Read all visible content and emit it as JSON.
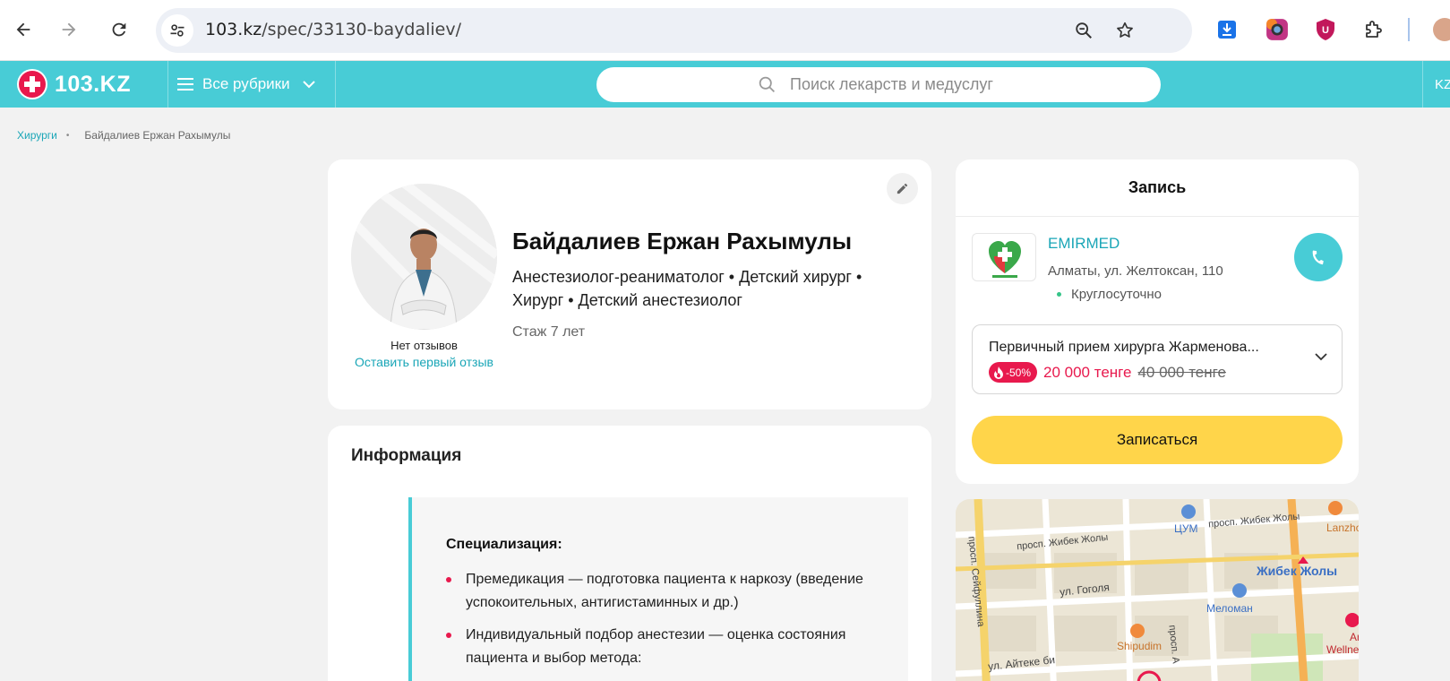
{
  "browser": {
    "url_host": "103.kz",
    "url_path": "/spec/33130-baydaliev/"
  },
  "header": {
    "logo_text": "103.KZ",
    "rubrics_label": "Все рубрики",
    "search_placeholder": "Поиск лекарств и медуслуг",
    "lang": "KZ"
  },
  "breadcrumb": {
    "parent": "Хирурги",
    "current": "Байдалиев Ержан Рахымулы"
  },
  "profile": {
    "name": "Байдалиев Ержан Рахымулы",
    "specialties": "Анестезиолог-реаниматолог • Детский хирург • Хирург • Детский анестезиолог",
    "experience": "Стаж 7 лет",
    "reviews_none": "Нет отзывов",
    "reviews_link": "Оставить первый отзыв"
  },
  "info": {
    "title": "Информация",
    "spec_heading": "Специализация:",
    "bullets": [
      "Премедикация — подготовка пациента к наркозу (введение успокоительных, антигистаминных и др.)",
      "Индивидуальный подбор анестезии — оценка состояния пациента и выбор метода:"
    ]
  },
  "booking": {
    "title": "Запись",
    "clinic_name": "EMIRMED",
    "clinic_address": "Алматы, ул. Желтоксан, 110",
    "clinic_hours": "Круглосуточно",
    "service_name": "Первичный прием хирурга Жарменова...",
    "discount": "-50%",
    "price_new": "20 000 тенге",
    "price_old": "40 000 тенге",
    "book_label": "Записаться"
  },
  "map": {
    "labels": {
      "cum": "ЦУМ",
      "zhibek1": "просп. Жибек Жолы",
      "zhibek2": "просп. Жибек Жолы",
      "seifullina": "просп. Сейфуллина",
      "gogolya": "ул. Гоголя",
      "aiteke": "ул. Айтеке би",
      "metro": "Жибек Жолы",
      "meloman": "Меломан",
      "shipudim": "Shipudim",
      "lanzhou": "Lanzho",
      "wellness": "Wellne",
      "ar": "Ar",
      "prosp_a": "просп. А"
    }
  },
  "colors": {
    "brand": "#48ccd6",
    "accent_red": "#e8194d",
    "button_yellow": "#ffd54a",
    "link": "#1aa6b7"
  }
}
